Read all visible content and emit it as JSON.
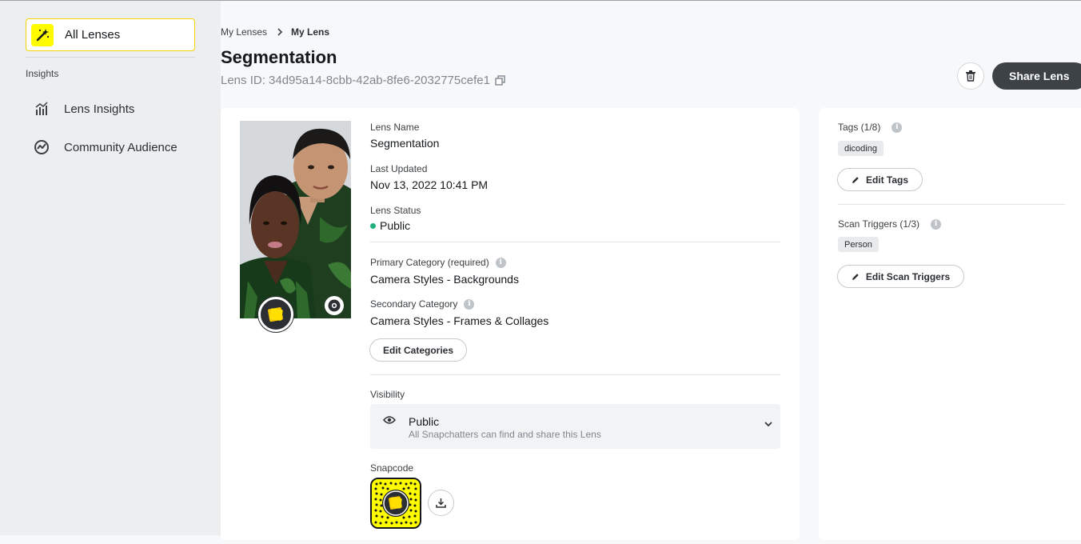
{
  "sidebar": {
    "all_lenses": {
      "label": "All Lenses",
      "icon": "magic-wand-icon"
    },
    "section_title": "Insights",
    "items": [
      {
        "label": "Lens Insights",
        "icon": "bar-chart-icon"
      },
      {
        "label": "Community Audience",
        "icon": "trend-circle-icon"
      }
    ]
  },
  "breadcrumb": {
    "parent": "My Lenses",
    "current": "My Lens"
  },
  "header": {
    "title": "Segmentation",
    "lens_id": "Lens ID: 34d95a14-8cbb-42ab-8fe6-2032775cefe1",
    "share_label": "Share Lens",
    "delete_icon": "trash-icon"
  },
  "details": {
    "lens_name_label": "Lens Name",
    "lens_name": "Segmentation",
    "last_updated_label": "Last Updated",
    "last_updated": "Nov 13, 2022 10:41 PM",
    "status_label": "Lens Status",
    "status": "Public",
    "status_color": "#1fb07a",
    "primary_category_label": "Primary Category (required)",
    "primary_category": "Camera Styles - Backgrounds",
    "secondary_category_label": "Secondary Category",
    "secondary_category": "Camera Styles - Frames & Collages",
    "edit_categories_label": "Edit Categories",
    "visibility_label": "Visibility",
    "visibility_value": "Public",
    "visibility_description": "All Snapchatters can find and share this Lens",
    "snapcode_label": "Snapcode"
  },
  "side": {
    "tags_label": "Tags (1/8)",
    "tags": [
      "dicoding"
    ],
    "edit_tags_label": "Edit Tags",
    "scan_triggers_label": "Scan Triggers (1/3)",
    "scan_triggers": [
      "Person"
    ],
    "edit_scan_triggers_label": "Edit Scan Triggers"
  },
  "colors": {
    "accent_yellow": "#fffc00",
    "share_button": "#3d4247"
  }
}
